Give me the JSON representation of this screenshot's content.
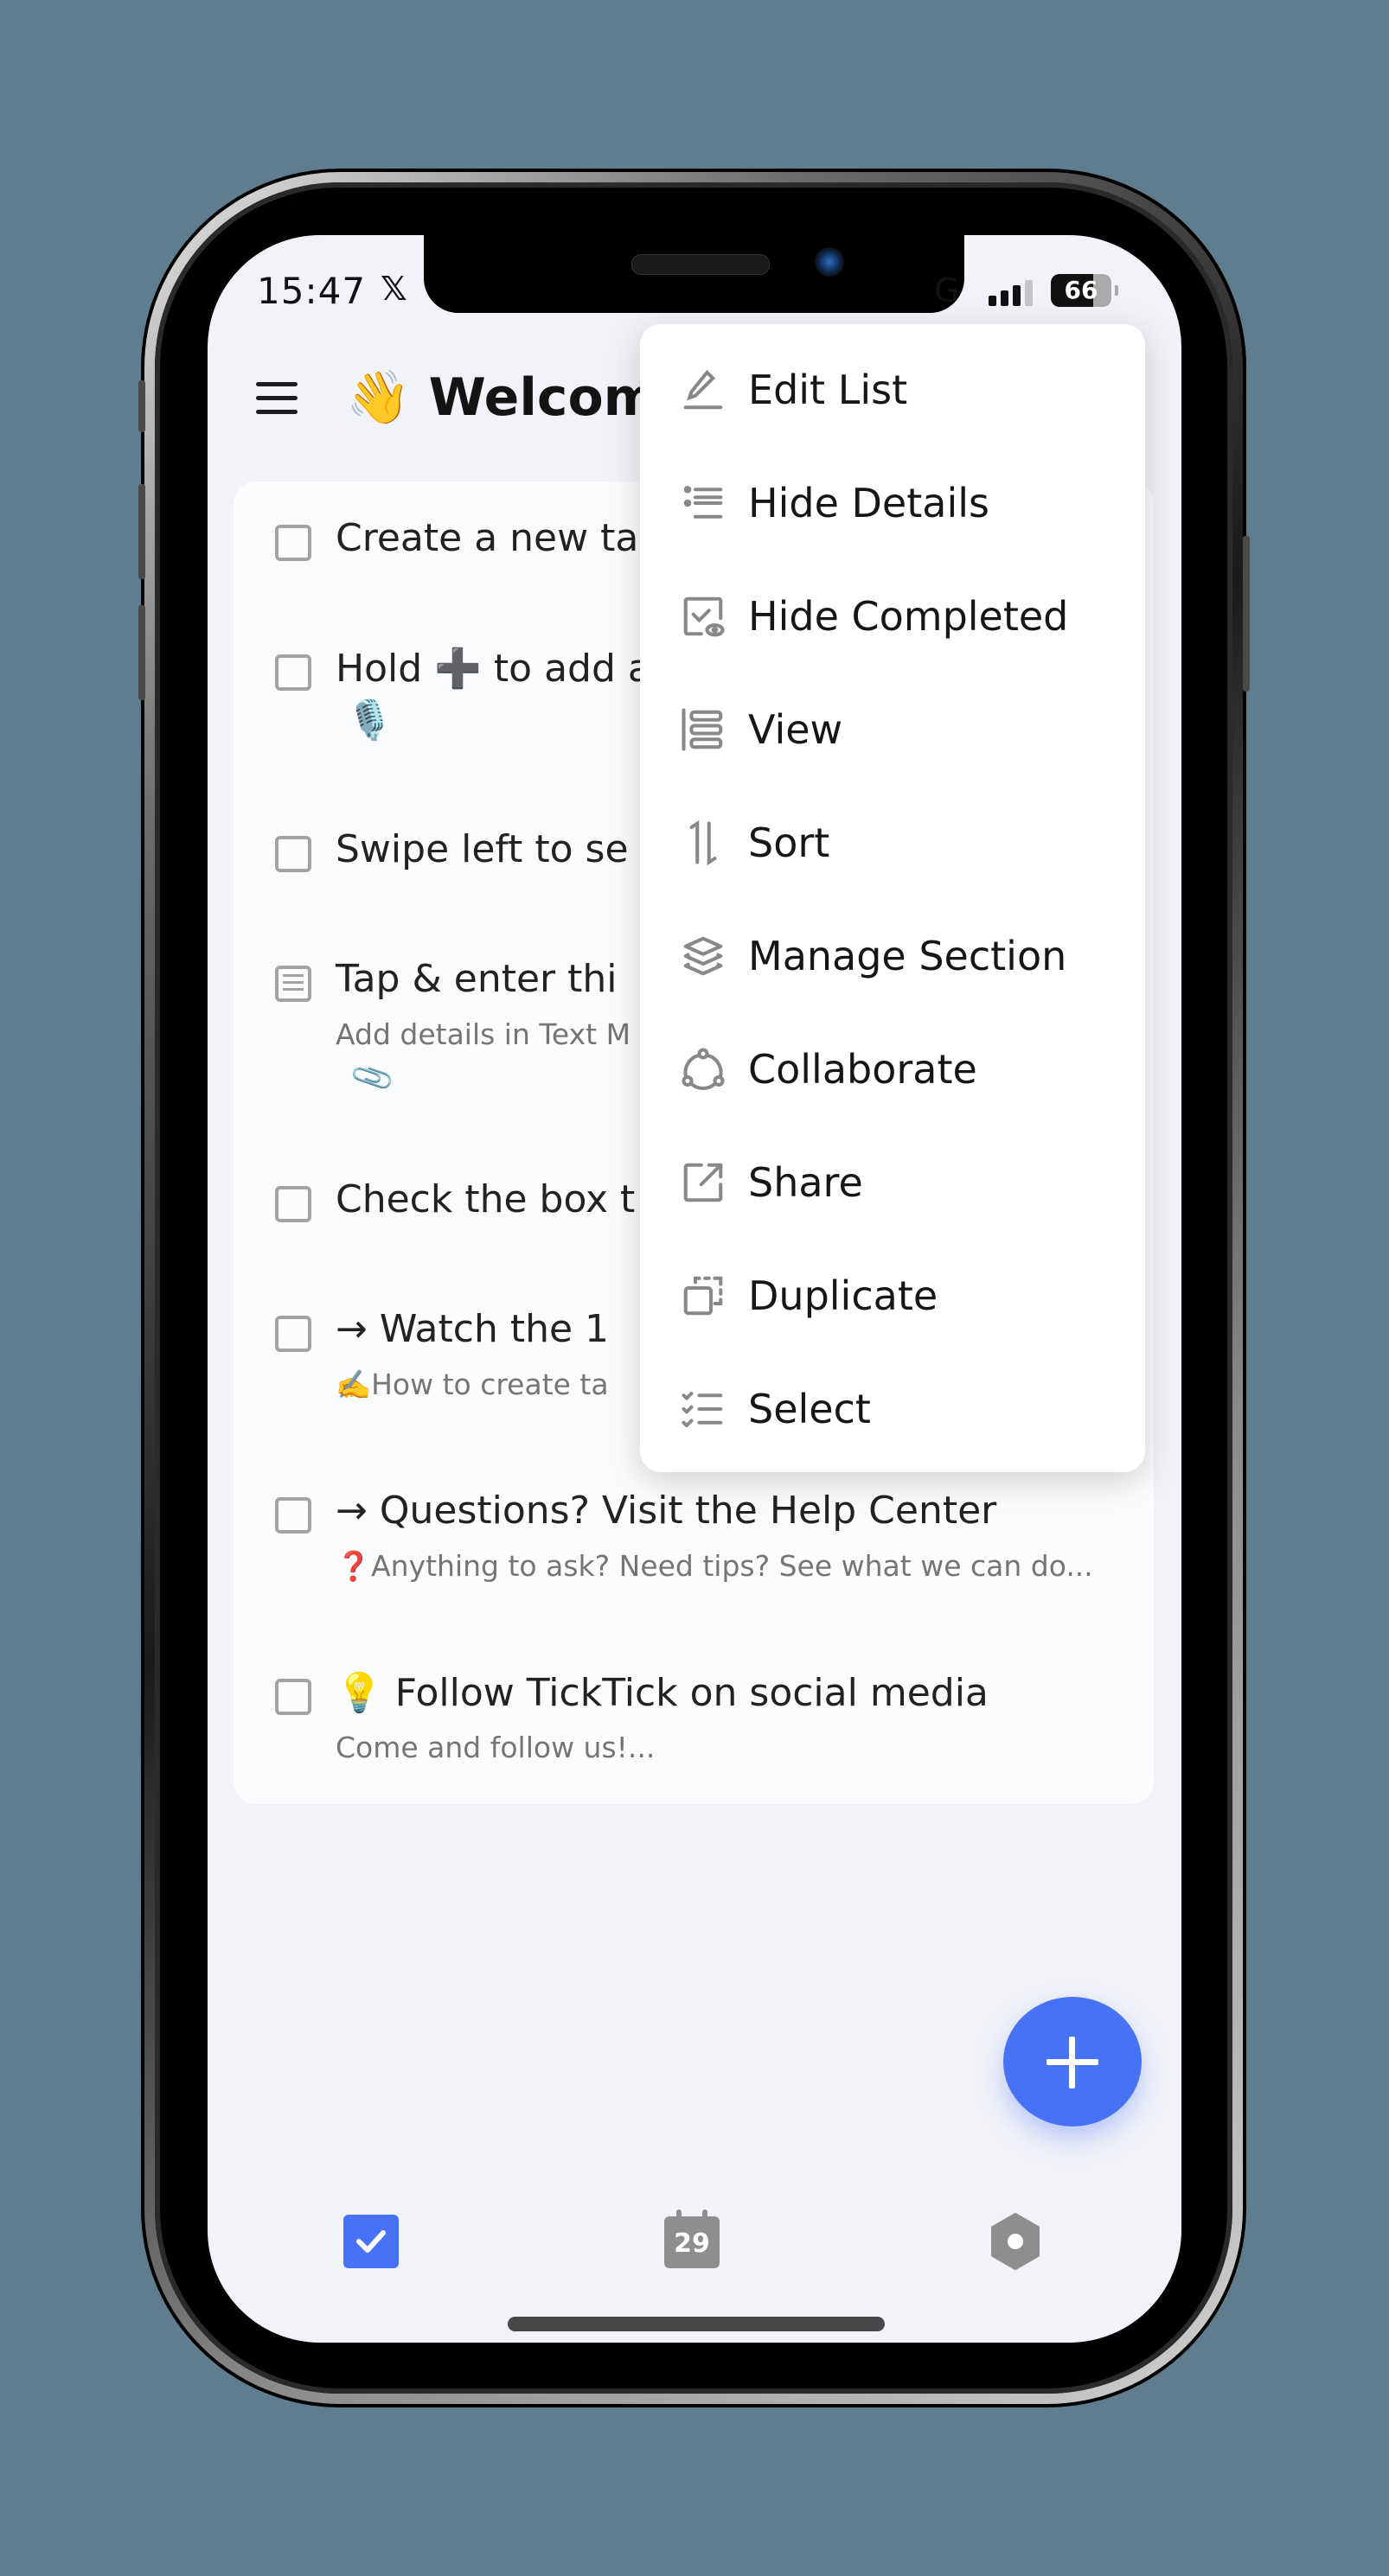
{
  "status_bar": {
    "time": "15:47",
    "x_icon": "𝕏",
    "network": "G",
    "battery": "66"
  },
  "header": {
    "title": "👋 Welcome"
  },
  "tasks": [
    {
      "title": "Create a new ta",
      "type": "checkbox"
    },
    {
      "title": "Hold ➕ to add a",
      "extra": "🎙️",
      "type": "checkbox"
    },
    {
      "title": "Swipe left to se",
      "type": "checkbox"
    },
    {
      "title": "Tap & enter thi",
      "subtitle": "Add details in Text M",
      "attachment": "📎",
      "type": "note"
    },
    {
      "title": "Check the box t",
      "type": "checkbox"
    },
    {
      "title": "→ Watch the 1",
      "subtitle": "✍️How to create ta",
      "type": "checkbox"
    },
    {
      "title": "→ Questions? Visit the Help Center",
      "subtitle": "❓Anything to ask? Need tips? See what we can do...",
      "type": "checkbox"
    },
    {
      "title": "💡 Follow TickTick on social media",
      "subtitle": "Come and follow us!...",
      "type": "checkbox"
    }
  ],
  "menu": {
    "items": [
      {
        "label": "Edit List",
        "icon": "pencil-icon"
      },
      {
        "label": "Hide Details",
        "icon": "list-details-icon"
      },
      {
        "label": "Hide Completed",
        "icon": "hide-completed-icon"
      },
      {
        "label": "View",
        "icon": "view-layout-icon"
      },
      {
        "label": "Sort",
        "icon": "sort-icon"
      },
      {
        "label": "Manage Section",
        "icon": "layers-icon"
      },
      {
        "label": "Collaborate",
        "icon": "collaborate-icon"
      },
      {
        "label": "Share",
        "icon": "share-icon"
      },
      {
        "label": "Duplicate",
        "icon": "duplicate-icon"
      },
      {
        "label": "Select",
        "icon": "select-list-icon"
      }
    ]
  },
  "bottom_nav": {
    "calendar_day": "29"
  },
  "colors": {
    "accent": "#4772f5",
    "background": "#f2f3f8",
    "card": "#fbfcfe",
    "icon_gray": "#8e8e8e",
    "frame_bg": "#5f7d8e"
  }
}
